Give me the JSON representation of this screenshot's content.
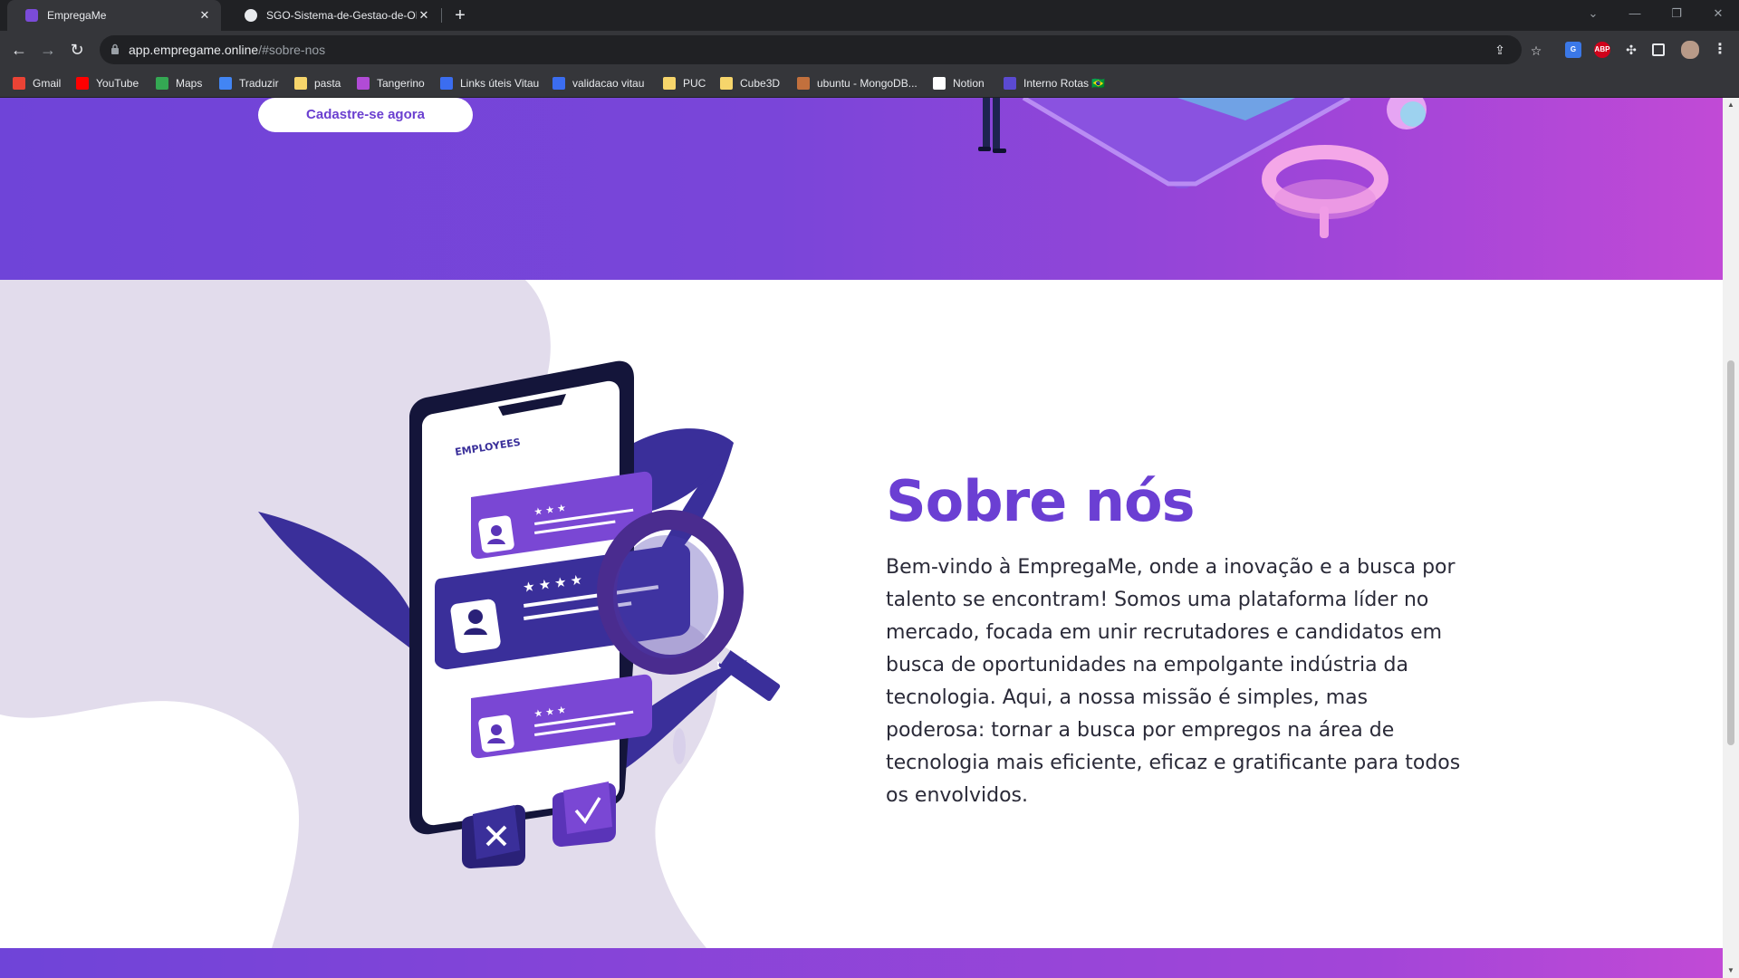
{
  "browser": {
    "tabs": [
      {
        "title": "EmpregaMe",
        "active": true
      },
      {
        "title": "SGO-Sistema-de-Gestao-de-ON",
        "active": false
      }
    ],
    "new_tab_icon": "plus-icon",
    "url_host": "app.empregame.online",
    "url_path": "/#sobre-nos",
    "bookmarks": [
      {
        "label": "Gmail",
        "icon": "gmail-icon",
        "color": "#ea4335"
      },
      {
        "label": "YouTube",
        "icon": "youtube-icon",
        "color": "#ff0000"
      },
      {
        "label": "Maps",
        "icon": "maps-icon",
        "color": "#34a853"
      },
      {
        "label": "Traduzir",
        "icon": "translate-icon",
        "color": "#4285f4"
      },
      {
        "label": "pasta",
        "icon": "folder-icon",
        "color": "#f6d56b"
      },
      {
        "label": "Tangerino",
        "icon": "tangerino-icon",
        "color": "#b14bd6"
      },
      {
        "label": "Links úteis Vitau",
        "icon": "vitau-icon",
        "color": "#3b6df0"
      },
      {
        "label": "validacao vitau",
        "icon": "vitau-icon",
        "color": "#3b6df0"
      },
      {
        "label": "PUC",
        "icon": "folder-icon",
        "color": "#f6d56b"
      },
      {
        "label": "Cube3D",
        "icon": "folder-icon",
        "color": "#f6d56b"
      },
      {
        "label": "ubuntu - MongoDB...",
        "icon": "ubuntu-icon",
        "color": "#c2703d"
      },
      {
        "label": "Notion",
        "icon": "notion-icon",
        "color": "#ffffff"
      },
      {
        "label": "Interno Rotas 🇧🇷",
        "icon": "rotas-icon",
        "color": "#5b4ad1"
      }
    ]
  },
  "hero": {
    "cta_label": "Cadastre-se agora"
  },
  "about": {
    "title": "Sobre nós",
    "text": "Bem-vindo à EmpregaMe, onde a inovação e a busca por talento se encontram! Somos uma plataforma líder no mercado, focada em unir recrutadores e candidatos em busca de oportunidades na empolgante indústria da tecnologia. Aqui, a nossa missão é simples, mas poderosa: tornar a busca por empregos na área de tecnologia mais eficiente, eficaz e gratificante para todos os envolvidos.",
    "illustration_label": "EMPLOYEES"
  },
  "colors": {
    "brand_purple": "#6b3fd3",
    "hero_gradient_start": "#6f44d8",
    "hero_gradient_end": "#c14ad6",
    "blob": "#e2dcec"
  }
}
